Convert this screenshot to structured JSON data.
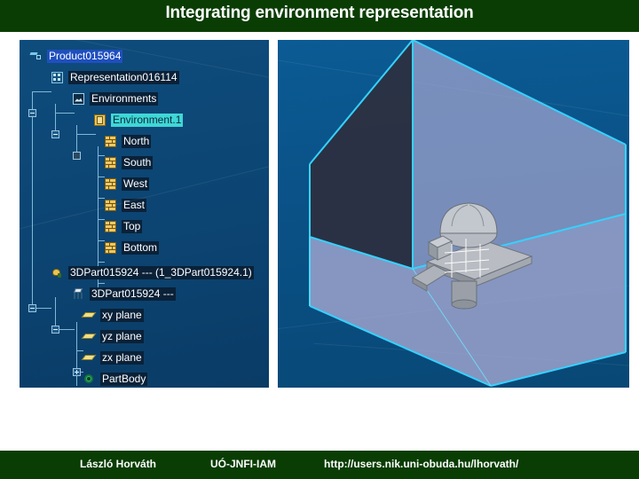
{
  "header": {
    "title": "Integrating environment representation",
    "bg_color": "#0a3d04",
    "text_color": "#ffffff"
  },
  "footer": {
    "author": "László Horváth",
    "organization": "UÓ-JNFI-IAM",
    "url": "http://users.nik.uni-obuda.hu/lhorvath/",
    "bg_color": "#0a3d04"
  },
  "tree_panel": {
    "bg_color": "#0c4472",
    "selected_blue": "#1f4fbf",
    "selected_cyan": "#3fd7d7",
    "items": [
      {
        "label": "Product015964",
        "icon": "product-icon",
        "depth": 0,
        "state": "selected-blue",
        "expander": "none"
      },
      {
        "label": "Representation016114",
        "icon": "representation-icon",
        "depth": 1,
        "state": "normal",
        "expander": "minus"
      },
      {
        "label": "Environments",
        "icon": "environments-icon",
        "depth": 2,
        "state": "normal",
        "expander": "minus"
      },
      {
        "label": "Environment.1",
        "icon": "environment-icon",
        "depth": 3,
        "state": "selected-cyan",
        "expander": "filled"
      },
      {
        "label": "North",
        "icon": "wall-icon",
        "depth": 4,
        "state": "normal",
        "expander": "none"
      },
      {
        "label": "South",
        "icon": "wall-icon",
        "depth": 4,
        "state": "normal",
        "expander": "none"
      },
      {
        "label": "West",
        "icon": "wall-icon",
        "depth": 4,
        "state": "normal",
        "expander": "none"
      },
      {
        "label": "East",
        "icon": "wall-icon",
        "depth": 4,
        "state": "normal",
        "expander": "none"
      },
      {
        "label": "Top",
        "icon": "wall-icon",
        "depth": 4,
        "state": "normal",
        "expander": "none"
      },
      {
        "label": "Bottom",
        "icon": "wall-icon",
        "depth": 4,
        "state": "normal",
        "expander": "none"
      },
      {
        "label": "3DPart015924 --- (1_3DPart015924.1)",
        "icon": "part-icon",
        "depth": 1,
        "state": "normal",
        "expander": "minus"
      },
      {
        "label": "3DPart015924 ---",
        "icon": "assembly-icon",
        "depth": 2,
        "state": "normal",
        "expander": "minus"
      },
      {
        "label": "xy plane",
        "icon": "plane-icon",
        "depth": 3,
        "state": "normal",
        "expander": "none"
      },
      {
        "label": "yz plane",
        "icon": "plane-icon",
        "depth": 3,
        "state": "normal",
        "expander": "none"
      },
      {
        "label": "zx plane",
        "icon": "plane-icon",
        "depth": 3,
        "state": "normal",
        "expander": "none"
      },
      {
        "label": "PartBody",
        "icon": "gear-icon",
        "depth": 3,
        "state": "normal",
        "expander": "plus"
      }
    ]
  },
  "viewport": {
    "bg_color": "#0a5288",
    "wireframe_color": "#35d2ff",
    "floor_color": "#a8a8d8",
    "back_wall_color": "#2a3040",
    "side_wall_color": "#9a9cc8",
    "model_color": "#b8bcc4",
    "description": "3D environment box with machine part model"
  }
}
